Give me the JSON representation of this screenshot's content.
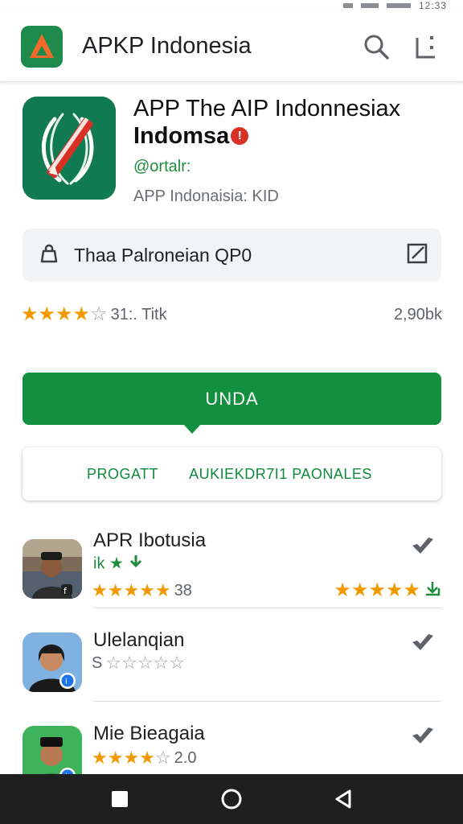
{
  "status_bar": {
    "time": "12:33"
  },
  "app_bar": {
    "title": "APKP Indonesia",
    "search_icon": "search-icon",
    "menu_icon": "more-icon"
  },
  "hero": {
    "title": "APP The AIP Indonnesiax",
    "subtitle": "Indomsa",
    "badge": "!",
    "developer": "@ortalr:",
    "meta": "APP Indonaisia: KID"
  },
  "search": {
    "value": "Thaa Palroneian QP0",
    "icon_left": "bag-icon",
    "icon_right": "edit-icon"
  },
  "rating": {
    "value": 3.5,
    "label": "31:. Titk",
    "count": "2,90bk"
  },
  "install_button": {
    "label": "UNDA"
  },
  "tabs": [
    {
      "label": "PROGATT"
    },
    {
      "label": "AUKIEKDR7I1 PAONALES"
    }
  ],
  "list": [
    {
      "title": "APR Ibotusia",
      "subtitle": "ik",
      "rating": 4.5,
      "score": "38",
      "right_rating": 4.5,
      "has_right_stars": true,
      "extra_icon": "download-icon"
    },
    {
      "title": "Ulelanqian",
      "subtitle": "",
      "rating": 0,
      "score": "S",
      "has_right_stars": false
    },
    {
      "title": "Mie Bieagaia",
      "subtitle": "",
      "rating": 4,
      "score": "2.0",
      "has_right_stars": false
    }
  ],
  "colors": {
    "primary_green": "#12903f",
    "accent_orange": "#f26b2b",
    "star": "#f29900"
  },
  "nav": [
    "recent-apps-icon",
    "home-icon",
    "back-icon"
  ]
}
